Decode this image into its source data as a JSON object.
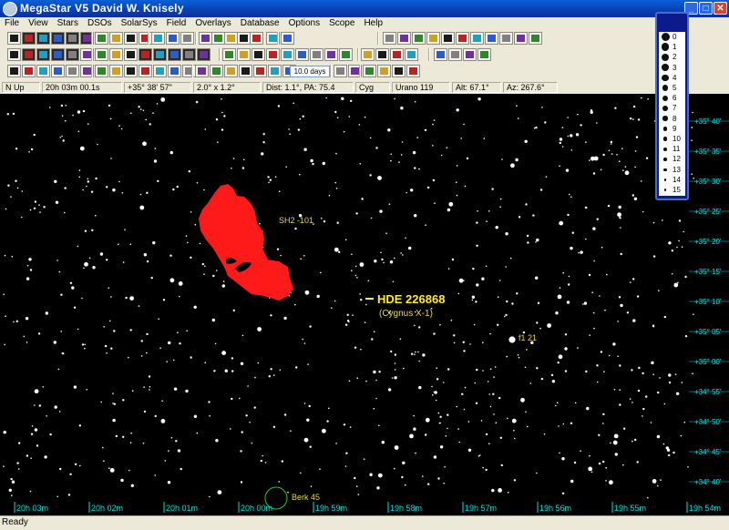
{
  "window": {
    "title": "MegaStar V5    David W. Knisely",
    "minimize": "_",
    "maximize": "□",
    "close": "✕"
  },
  "menu": [
    "File",
    "View",
    "Stars",
    "DSOs",
    "SolarSys",
    "Field",
    "Overlays",
    "Database",
    "Options",
    "Scope",
    "Help"
  ],
  "toolbar": {
    "time_step": "10.0 days"
  },
  "status": {
    "orientation": "N Up",
    "ra": "20h 03m 00.1s",
    "dec": "+35° 38' 57\"",
    "field_size": "2.0° x 1.2°",
    "dist_pa": "Dist: 1.1°, PA: 75.4",
    "constellation": "Cyg",
    "atlas": "Urano 119",
    "alt": "Alt: 67.1°",
    "az": "Az: 267.6°"
  },
  "chart": {
    "objects": {
      "target_name": "HDE 226868",
      "target_alias": "(Cygnus X-1)",
      "nebula_label": "SH2 -101",
      "star_label": "f1 21",
      "cluster_label": "Berk 45"
    },
    "ra_ticks": [
      "20h 03m",
      "20h 02m",
      "20h 01m",
      "20h 00m",
      "19h 59m",
      "19h 58m",
      "19h 57m",
      "19h 56m",
      "19h 55m",
      "19h 54m"
    ],
    "dec_ticks": [
      "+35° 40'",
      "+35° 35'",
      "+35° 30'",
      "+35° 25'",
      "+35° 20'",
      "+35° 15'",
      "+35° 10'",
      "+35° 05'",
      "+35° 00'",
      "+34° 55'",
      "+34° 50'",
      "+34° 45'",
      "+34° 40'"
    ],
    "colors": {
      "background": "#000000",
      "nebula": "#ff1a1a",
      "labels": "#e8d84a",
      "target": "#ffee22",
      "grid_labels": "#00e0e0"
    }
  },
  "magnitude_legend": [
    "0",
    "1",
    "2",
    "3",
    "4",
    "5",
    "6",
    "7",
    "8",
    "9",
    "10",
    "11",
    "12",
    "13",
    "14",
    "15"
  ],
  "footer": {
    "status": "Ready"
  }
}
